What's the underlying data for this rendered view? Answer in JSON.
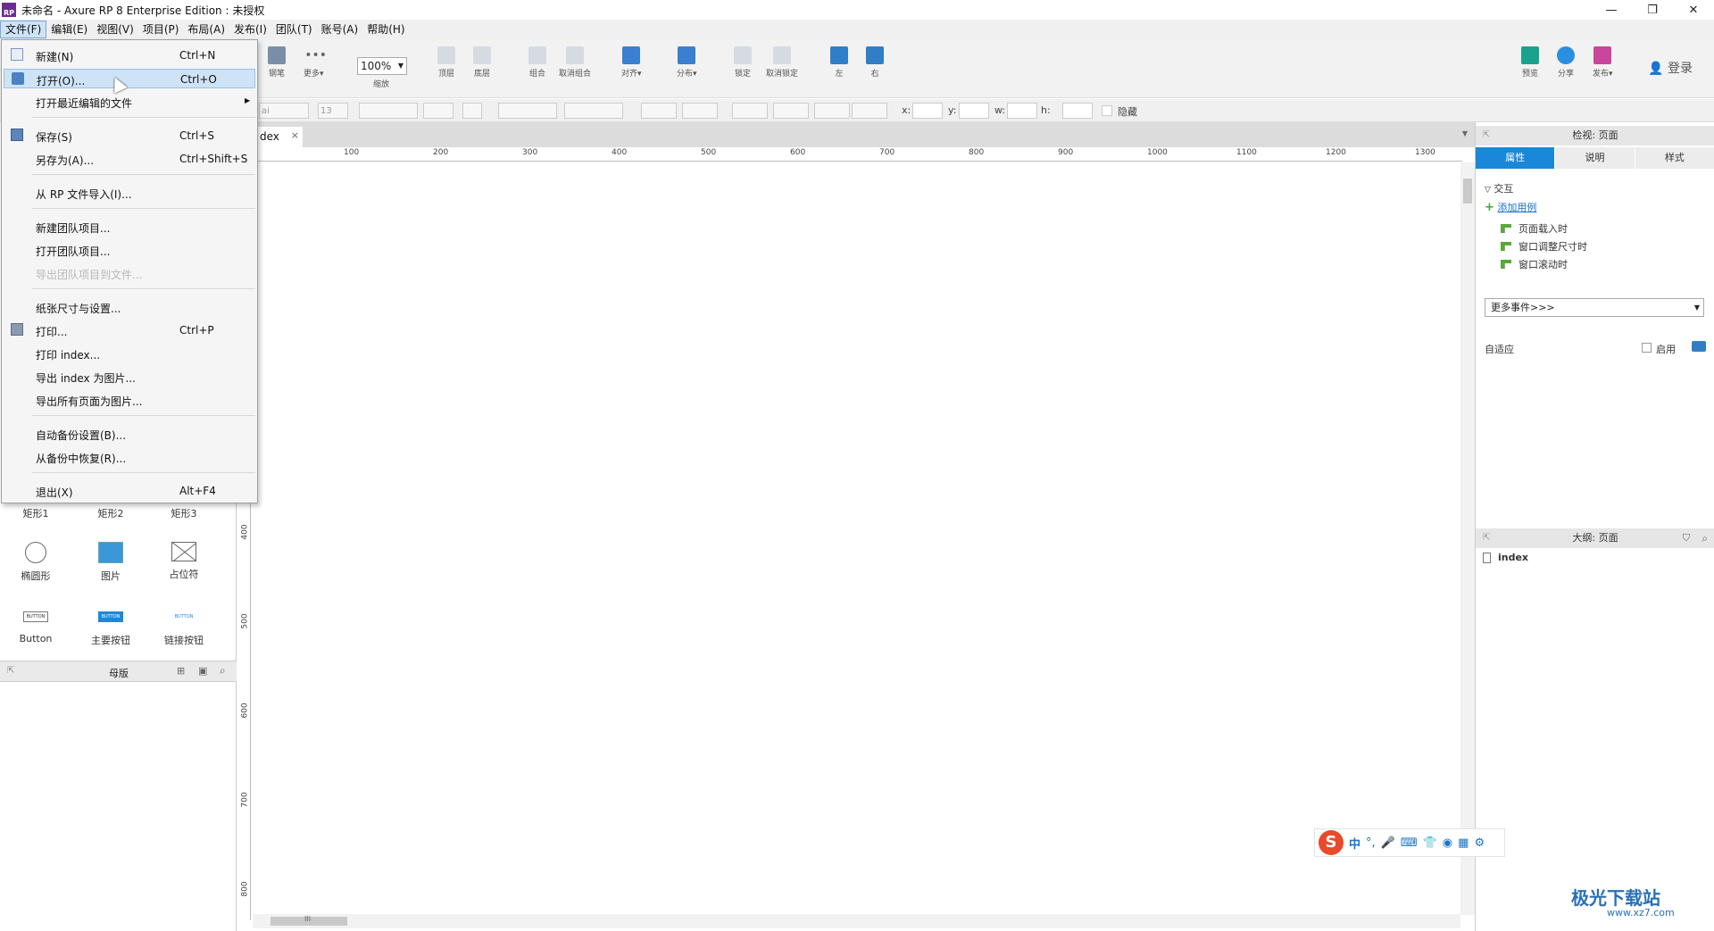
{
  "window": {
    "title": "未命名 - Axure RP 8 Enterprise Edition : 未授权",
    "logo_text": "RP",
    "minimize": "—",
    "restore": "❐",
    "close": "✕"
  },
  "menubar": [
    "文件(F)",
    "编辑(E)",
    "视图(V)",
    "项目(P)",
    "布局(A)",
    "发布(I)",
    "团队(T)",
    "账号(A)",
    "帮助(H)"
  ],
  "toolbar": {
    "items": [
      {
        "label": "钢笔",
        "icon": "pen-icon"
      },
      {
        "label": "更多▾",
        "icon": "more-icon"
      },
      {
        "label": "顶层",
        "icon": "bring-front-icon"
      },
      {
        "label": "底层",
        "icon": "send-back-icon"
      },
      {
        "label": "组合",
        "icon": "group-icon"
      },
      {
        "label": "取消组合",
        "icon": "ungroup-icon"
      },
      {
        "label": "对齐▾",
        "icon": "align-icon"
      },
      {
        "label": "分布▾",
        "icon": "distribute-icon"
      },
      {
        "label": "锁定",
        "icon": "lock-icon"
      },
      {
        "label": "取消锁定",
        "icon": "unlock-icon"
      },
      {
        "label": "左",
        "icon": "left-panel-icon"
      },
      {
        "label": "右",
        "icon": "right-panel-icon"
      },
      {
        "label": "预览",
        "icon": "preview-icon"
      },
      {
        "label": "分享",
        "icon": "share-icon"
      },
      {
        "label": "发布▾",
        "icon": "publish-icon"
      }
    ],
    "zoom_value": "100%",
    "zoom_label": "缩放",
    "login": "登录"
  },
  "formatbar": {
    "font_partial": "ai",
    "font_size": "13",
    "x_label": "x:",
    "y_label": "y:",
    "w_label": "w:",
    "h_label": "h:",
    "hidden_label": "隐藏"
  },
  "file_menu": {
    "items": [
      {
        "label": "新建(N)",
        "shortcut": "Ctrl+N"
      },
      {
        "label": "打开(O)...",
        "shortcut": "Ctrl+O"
      },
      {
        "label": "打开最近编辑的文件",
        "shortcut": ""
      },
      {
        "label": "保存(S)",
        "shortcut": "Ctrl+S"
      },
      {
        "label": "另存为(A)...",
        "shortcut": "Ctrl+Shift+S"
      },
      {
        "label": "从 RP 文件导入(I)...",
        "shortcut": ""
      },
      {
        "label": "新建团队项目...",
        "shortcut": ""
      },
      {
        "label": "打开团队项目...",
        "shortcut": ""
      },
      {
        "label": "导出团队项目到文件...",
        "shortcut": ""
      },
      {
        "label": "纸张尺寸与设置...",
        "shortcut": ""
      },
      {
        "label": "打印...",
        "shortcut": "Ctrl+P"
      },
      {
        "label": "打印 index...",
        "shortcut": ""
      },
      {
        "label": "导出 index 为图片...",
        "shortcut": ""
      },
      {
        "label": "导出所有页面为图片...",
        "shortcut": ""
      },
      {
        "label": "自动备份设置(B)...",
        "shortcut": ""
      },
      {
        "label": "从备份中恢复(R)...",
        "shortcut": ""
      },
      {
        "label": "退出(X)",
        "shortcut": "Alt+F4"
      }
    ]
  },
  "widgets": [
    {
      "label": "矩形1"
    },
    {
      "label": "矩形2"
    },
    {
      "label": "矩形3"
    },
    {
      "label": "椭圆形"
    },
    {
      "label": "图片"
    },
    {
      "label": "占位符"
    },
    {
      "label": "Button"
    },
    {
      "label": "主要按钮"
    },
    {
      "label": "链接按钮"
    }
  ],
  "widget_button_text": "BUTTON",
  "masters": {
    "title": "母版"
  },
  "canvas": {
    "tab_label": "dex",
    "tab_close": "×",
    "ruler_top": [
      "100",
      "200",
      "300",
      "400",
      "500",
      "600",
      "700",
      "800",
      "900",
      "1000",
      "1100",
      "1200",
      "1300"
    ],
    "ruler_left": [
      "400",
      "500",
      "600",
      "700",
      "800"
    ],
    "scroll_grip": "III"
  },
  "inspector": {
    "title": "检视: 页面",
    "tabs": [
      "属性",
      "说明",
      "样式"
    ],
    "interaction_label": "交互",
    "add_case": "添加用例",
    "events": [
      "页面载入时",
      "窗口调整尺寸时",
      "窗口滚动时"
    ],
    "more_events": "更多事件>>>",
    "adaptive_label": "自适应",
    "enable_label": "启用"
  },
  "outline": {
    "title": "大纲: 页面",
    "page": "index"
  },
  "ime": {
    "logo": "S",
    "chinese": "中",
    "punct": "°,"
  },
  "watermark": {
    "name": "极光下载站",
    "url": "www.xz7.com"
  }
}
